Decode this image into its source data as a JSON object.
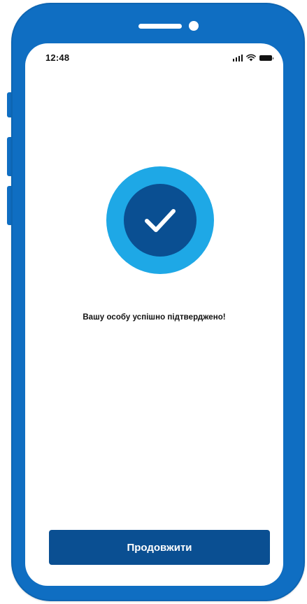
{
  "status_bar": {
    "time": "12:48",
    "icons": [
      "signal-icon",
      "wifi-icon",
      "battery-icon"
    ]
  },
  "verification": {
    "icon": "check-icon",
    "message": "Вашу особу успішно підтверджено!"
  },
  "actions": {
    "continue_label": "Продовжити"
  },
  "colors": {
    "frame": "#0f6ec2",
    "badge_outer": "#1ea8e6",
    "badge_inner": "#0a4f92",
    "button": "#0a4f92",
    "check": "#ffffff"
  }
}
